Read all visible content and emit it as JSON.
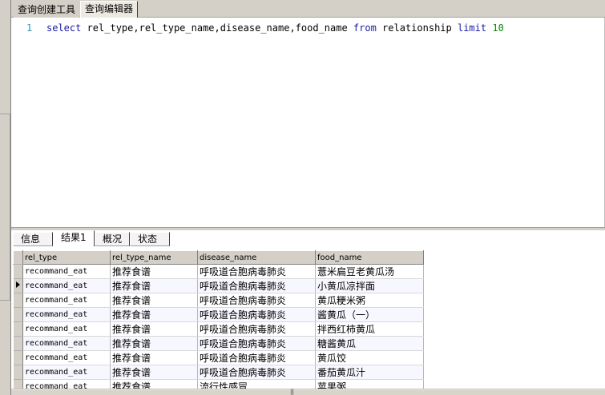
{
  "top_tabs": [
    {
      "label": "查询创建工具",
      "active": false
    },
    {
      "label": "查询编辑器",
      "active": true
    }
  ],
  "editor": {
    "line_number": "1",
    "tokens": [
      {
        "text": "select",
        "kind": "keyword"
      },
      {
        "text": " rel_type,rel_type_name,disease_name,food_name ",
        "kind": "plain"
      },
      {
        "text": "from",
        "kind": "keyword"
      },
      {
        "text": " relationship ",
        "kind": "plain"
      },
      {
        "text": "limit",
        "kind": "keyword"
      },
      {
        "text": " ",
        "kind": "plain"
      },
      {
        "text": "10",
        "kind": "number"
      }
    ]
  },
  "result_tabs": [
    {
      "label": "信息",
      "active": false
    },
    {
      "label": "结果1",
      "active": true
    },
    {
      "label": "概况",
      "active": false
    },
    {
      "label": "状态",
      "active": false
    }
  ],
  "grid": {
    "columns": [
      "rel_type",
      "rel_type_name",
      "disease_name",
      "food_name"
    ],
    "current_row": 1,
    "rows": [
      [
        "recommand_eat",
        "推荐食谱",
        "呼吸道合胞病毒肺炎",
        "薏米扁豆老黄瓜汤"
      ],
      [
        "recommand_eat",
        "推荐食谱",
        "呼吸道合胞病毒肺炎",
        "小黄瓜凉拌面"
      ],
      [
        "recommand_eat",
        "推荐食谱",
        "呼吸道合胞病毒肺炎",
        "黄瓜粳米粥"
      ],
      [
        "recommand_eat",
        "推荐食谱",
        "呼吸道合胞病毒肺炎",
        "酱黄瓜（一）"
      ],
      [
        "recommand_eat",
        "推荐食谱",
        "呼吸道合胞病毒肺炎",
        "拌西红柿黄瓜"
      ],
      [
        "recommand_eat",
        "推荐食谱",
        "呼吸道合胞病毒肺炎",
        "糖酱黄瓜"
      ],
      [
        "recommand_eat",
        "推荐食谱",
        "呼吸道合胞病毒肺炎",
        "黄瓜饺"
      ],
      [
        "recommand_eat",
        "推荐食谱",
        "呼吸道合胞病毒肺炎",
        "番茄黄瓜汁"
      ],
      [
        "recommand_eat",
        "推荐食谱",
        "流行性感冒",
        "苹果粥"
      ]
    ]
  },
  "colors": {
    "keyword": "#1a1aa6",
    "number": "#098609",
    "line_number": "#2b91af",
    "chrome": "#d4d0c8"
  }
}
